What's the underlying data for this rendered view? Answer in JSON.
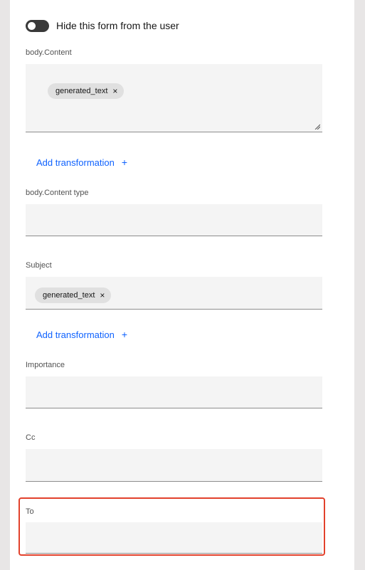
{
  "form": {
    "toggle_label": "Hide this form from the user",
    "toggle_on": false,
    "fields": {
      "body_content": {
        "label": "body.Content",
        "chips": [
          "generated_text"
        ]
      },
      "add_transformation_1": "Add transformation",
      "body_content_type": {
        "label": "body.Content type",
        "value": ""
      },
      "subject": {
        "label": "Subject",
        "chips": [
          "generated_text"
        ]
      },
      "add_transformation_2": "Add transformation",
      "importance": {
        "label": "Importance",
        "value": ""
      },
      "cc": {
        "label": "Cc",
        "value": ""
      },
      "to": {
        "label": "To",
        "value": ""
      }
    }
  },
  "icons": {
    "chip_remove": "×",
    "add": "+"
  },
  "colors": {
    "link": "#0f62fe",
    "highlight": "#e2412c",
    "field_bg": "#f4f4f4"
  }
}
